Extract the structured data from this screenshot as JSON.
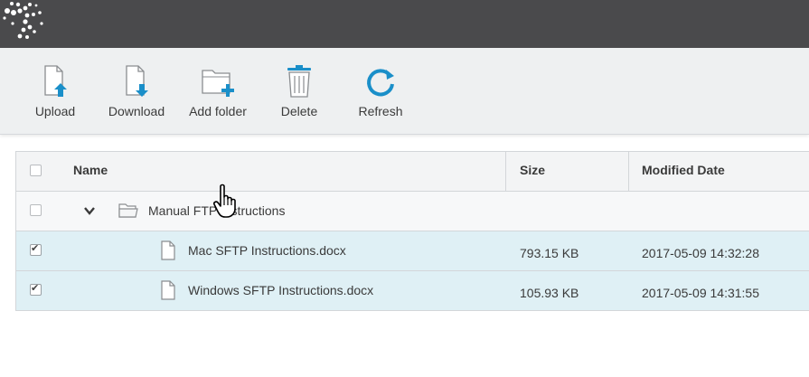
{
  "toolbar": {
    "upload_label": "Upload",
    "download_label": "Download",
    "add_folder_label": "Add folder",
    "delete_label": "Delete",
    "refresh_label": "Refresh"
  },
  "table": {
    "columns": [
      "Name",
      "Size",
      "Modified Date"
    ],
    "folder": {
      "name": "Manual FTP Instructions",
      "checked": false,
      "expanded": true
    },
    "rows": [
      {
        "name": "Mac SFTP Instructions.docx",
        "size": "793.15 KB",
        "modified": "2017-05-09 14:32:28",
        "checked": true
      },
      {
        "name": "Windows SFTP Instructions.docx",
        "size": "105.93 KB",
        "modified": "2017-05-09 14:31:55",
        "checked": true
      }
    ]
  },
  "colors": {
    "topbar": "#4a4a4c",
    "accent": "#1a8fc9",
    "selected_row": "#dff0f5"
  }
}
